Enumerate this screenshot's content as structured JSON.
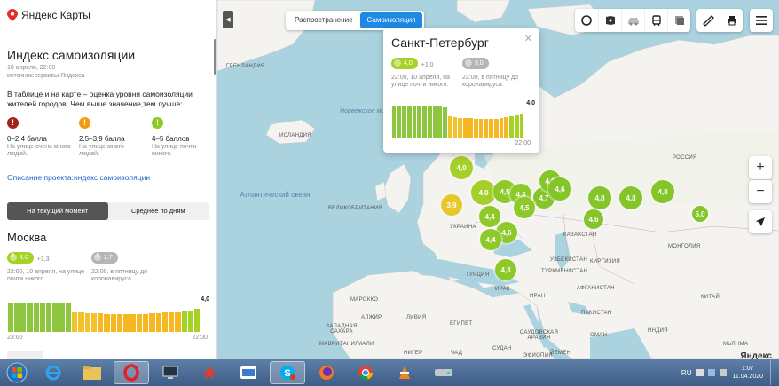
{
  "brand": {
    "name": "Яндекс Карты"
  },
  "sidebar": {
    "title": "Индекс самоизоляции",
    "date": "10 апреля, 22:00",
    "source": "источник:сервисы Яндекса",
    "description": "В таблице и на карте – оценка уровня самоизоляции жителей городов. Чем выше значение,тем лучше:",
    "legend": [
      {
        "range": "0–2.4 балла",
        "caption": "На улице очень много людей.",
        "color": "#c0392b"
      },
      {
        "range": "2.5–3.9 балла",
        "caption": "На улице много людей.",
        "color": "#f39c12"
      },
      {
        "range": "4–5 баллов",
        "caption": "На улице почти никого.",
        "color": "#8ac926"
      }
    ],
    "project_link": "Описание проекта:индекс самоизоляции",
    "tabs": [
      {
        "label": "На текущий момент",
        "active": true
      },
      {
        "label": "Среднее по дням",
        "active": false
      }
    ],
    "city": "Москва",
    "current": {
      "value": "4,0",
      "delta": "+1,3",
      "note": "22:00, 10 апреля, на улице почти никого."
    },
    "previous": {
      "value": "2,7",
      "note": "22:00, в пятницу до коронавируса"
    },
    "chart": {
      "max_label": "4,0",
      "start_label": "23:00",
      "end_label": "22:00"
    }
  },
  "map": {
    "segment": [
      {
        "label": "Распространение",
        "active": false
      },
      {
        "label": "Самоизоляция",
        "active": true
      }
    ],
    "toolbar_icons": [
      "layers-icon",
      "panorama-icon",
      "traffic-icon",
      "transit-icon",
      "map-type-icon"
    ],
    "toolbar_icons2": [
      "ruler-icon",
      "print-icon"
    ],
    "menu_icon": "menu-icon",
    "zoom_in": "+",
    "zoom_out": "−",
    "labels": [
      {
        "text": "ГРЕНЛАНДИЯ",
        "kind": "country"
      },
      {
        "text": "ИСЛАНДИЯ",
        "kind": "country"
      },
      {
        "text": "Норвежское море",
        "kind": "sea"
      },
      {
        "text": "Атлантический океан",
        "kind": "ocean"
      },
      {
        "text": "ВЕЛИКОБРИТАНИЯ",
        "kind": "country"
      },
      {
        "text": "УКРАИНА",
        "kind": "country"
      },
      {
        "text": "КАЗАХСТАН",
        "kind": "country"
      },
      {
        "text": "РОССИЯ",
        "kind": "country"
      },
      {
        "text": "МОНГОЛИЯ",
        "kind": "country"
      },
      {
        "text": "УЗБЕКИСТАН",
        "kind": "country"
      },
      {
        "text": "ТУРКМЕНИСТАН",
        "kind": "country"
      },
      {
        "text": "КИРГИЗИЯ",
        "kind": "country"
      },
      {
        "text": "ТУРЦИЯ",
        "kind": "country"
      },
      {
        "text": "ИРАК",
        "kind": "country"
      },
      {
        "text": "ИРАН",
        "kind": "country"
      },
      {
        "text": "АФГАНИСТАН",
        "kind": "country"
      },
      {
        "text": "ПАКИСТАН",
        "kind": "country"
      },
      {
        "text": "МАРОККО",
        "kind": "country"
      },
      {
        "text": "АЛЖИР",
        "kind": "country"
      },
      {
        "text": "ЛИВИЯ",
        "kind": "country"
      },
      {
        "text": "ЕГИПЕТ",
        "kind": "country"
      },
      {
        "text": "ЗАПАДНАЯ САХАРА",
        "kind": "country"
      },
      {
        "text": "МАВРИТАНИЯ",
        "kind": "country"
      },
      {
        "text": "МАЛИ",
        "kind": "country"
      },
      {
        "text": "НИГЕР",
        "kind": "country"
      },
      {
        "text": "ЧАД",
        "kind": "country"
      },
      {
        "text": "СУДАН",
        "kind": "country"
      },
      {
        "text": "САУДОВСКАЯ АРАВИЯ",
        "kind": "country"
      },
      {
        "text": "ОМАН",
        "kind": "country"
      },
      {
        "text": "ЙЕМЕН",
        "kind": "country"
      },
      {
        "text": "ЭФИОПИЯ",
        "kind": "country"
      },
      {
        "text": "ИНДИЯ",
        "kind": "country"
      },
      {
        "text": "КИТАЙ",
        "kind": "country"
      },
      {
        "text": "МЬЯНМА",
        "kind": "country"
      }
    ],
    "bubbles": [
      "4,0",
      "3,9",
      "4,0",
      "4,5",
      "4,4",
      "4,7",
      "4,8",
      "4,6",
      "4,8",
      "4,8",
      "4,8",
      "5,0",
      "4,4",
      "4,6",
      "4,4",
      "4,6",
      "4,3",
      "4,5"
    ],
    "popup": {
      "city": "Санкт-Петербург",
      "current": {
        "value": "4,0",
        "delta": "+1,0",
        "note": "22:00, 10 апреля, на улице почти никого."
      },
      "previous": {
        "value": "3,0",
        "note": "22:00, в пятницу до коронавируса"
      },
      "chart": {
        "max_label": "4,0",
        "end_label": "22:00"
      }
    },
    "copyright": "Яндекс"
  },
  "taskbar": {
    "lang": "RU",
    "time": "1:07",
    "date": "11.04.2020"
  },
  "colors": {
    "green": "#a6d125",
    "yellow": "#f2c94c",
    "orange": "#f39c12",
    "red": "#c0392b",
    "accent": "#1e88e5"
  }
}
